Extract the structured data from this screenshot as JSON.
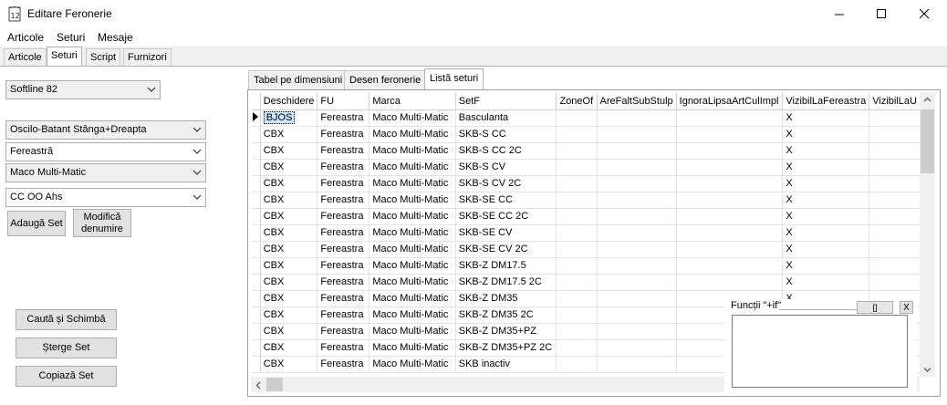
{
  "window": {
    "title": "Editare Feronerie",
    "icon_label": "12"
  },
  "menu": [
    "Articole",
    "Seturi",
    "Mesaje"
  ],
  "tabs": [
    {
      "label": "Articole",
      "active": false
    },
    {
      "label": "Seturi",
      "active": true
    },
    {
      "label": "Script",
      "active": false
    },
    {
      "label": "Furnizori",
      "active": false
    }
  ],
  "left_panel": {
    "profile_select": "Softline 82",
    "opening_select": "Oscilo-Batant Stânga+Dreapta",
    "type_select": "Fereastră",
    "brand_select": "Maco Multi-Matic",
    "set_select": "CC OO Ahs",
    "add_set_button": "Adaugă Set",
    "rename_button_line1": "Modifică",
    "rename_button_line2": "denumire",
    "find_replace_button": "Caută și Schimbă",
    "delete_set_button": "Șterge Set",
    "copy_set_button": "Copiază Set"
  },
  "inner_tabs": [
    {
      "label": "Tabel pe dimensiuni",
      "active": false
    },
    {
      "label": "Desen feronerie",
      "active": false
    },
    {
      "label": "Listă seturi",
      "active": true
    }
  ],
  "grid": {
    "columns": [
      "Deschidere",
      "FU",
      "Marca",
      "SetF",
      "ZoneOf",
      "AreFaltSubStulp",
      "IgnoraLipsaArtCulImpl",
      "VizibilLaFereastra",
      "VizibilLaU"
    ],
    "rows": [
      [
        "BJOS",
        "Fereastra",
        "Maco Multi-Matic",
        "Basculanta",
        "",
        "",
        "",
        "X",
        ""
      ],
      [
        "CBX",
        "Fereastra",
        "Maco Multi-Matic",
        "SKB-S CC",
        "",
        "",
        "",
        "X",
        ""
      ],
      [
        "CBX",
        "Fereastra",
        "Maco Multi-Matic",
        "SKB-S CC 2C",
        "",
        "",
        "",
        "X",
        ""
      ],
      [
        "CBX",
        "Fereastra",
        "Maco Multi-Matic",
        "SKB-S CV",
        "",
        "",
        "",
        "X",
        ""
      ],
      [
        "CBX",
        "Fereastra",
        "Maco Multi-Matic",
        "SKB-S CV 2C",
        "",
        "",
        "",
        "X",
        ""
      ],
      [
        "CBX",
        "Fereastra",
        "Maco Multi-Matic",
        "SKB-SE CC",
        "",
        "",
        "",
        "X",
        ""
      ],
      [
        "CBX",
        "Fereastra",
        "Maco Multi-Matic",
        "SKB-SE CC 2C",
        "",
        "",
        "",
        "X",
        ""
      ],
      [
        "CBX",
        "Fereastra",
        "Maco Multi-Matic",
        "SKB-SE CV",
        "",
        "",
        "",
        "X",
        ""
      ],
      [
        "CBX",
        "Fereastra",
        "Maco Multi-Matic",
        "SKB-SE CV 2C",
        "",
        "",
        "",
        "X",
        ""
      ],
      [
        "CBX",
        "Fereastra",
        "Maco Multi-Matic",
        "SKB-Z DM17.5",
        "",
        "",
        "",
        "X",
        ""
      ],
      [
        "CBX",
        "Fereastra",
        "Maco Multi-Matic",
        "SKB-Z DM17.5 2C",
        "",
        "",
        "",
        "X",
        ""
      ],
      [
        "CBX",
        "Fereastra",
        "Maco Multi-Matic",
        "SKB-Z DM35",
        "",
        "",
        "",
        "X",
        ""
      ],
      [
        "CBX",
        "Fereastra",
        "Maco Multi-Matic",
        "SKB-Z DM35 2C",
        "",
        "",
        "",
        "",
        ""
      ],
      [
        "CBX",
        "Fereastra",
        "Maco Multi-Matic",
        "SKB-Z DM35+PZ",
        "",
        "",
        "",
        "",
        ""
      ],
      [
        "CBX",
        "Fereastra",
        "Maco Multi-Matic",
        "SKB-Z DM35+PZ 2C",
        "",
        "",
        "",
        "",
        ""
      ],
      [
        "CBX",
        "Fereastra",
        "Maco Multi-Matic",
        "SKB inactiv",
        "",
        "",
        "",
        "",
        ""
      ]
    ]
  },
  "popup": {
    "title": "Funcții \"+if\"",
    "restore_label": "[]",
    "close_label": "X"
  }
}
